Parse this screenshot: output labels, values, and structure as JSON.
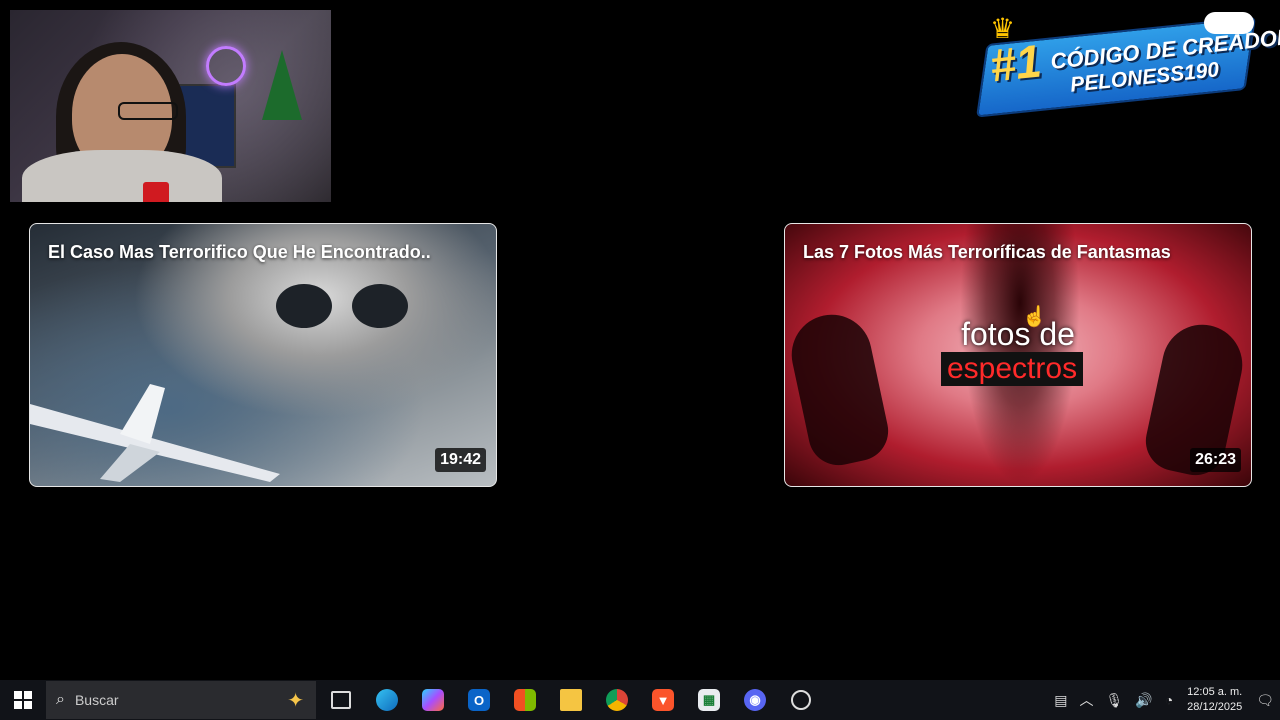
{
  "creator_badge": {
    "rank": "#1",
    "line1": "CÓDIGO DE CREADOR:",
    "line2": "PELONESS190"
  },
  "videos": [
    {
      "title": "El Caso Mas Terrorifico Que He Encontrado..",
      "duration": "19:42"
    },
    {
      "title": "Las 7 Fotos Más Terroríficas de Fantasmas",
      "duration": "26:23",
      "overlay_line1": "fotos de",
      "overlay_line2": "espectros"
    }
  ],
  "taskbar": {
    "search_placeholder": "Buscar",
    "apps": [
      "task-view",
      "edge",
      "copilot",
      "outlook",
      "store",
      "file-explorer",
      "chrome",
      "brave",
      "app",
      "discord",
      "app2"
    ],
    "clock_time": "12:05 a. m.",
    "clock_date": "28/12/2025"
  },
  "colors": {
    "badge_blue": "#1667c9",
    "badge_gold": "#ffd54a",
    "taskbar": "#111318"
  }
}
